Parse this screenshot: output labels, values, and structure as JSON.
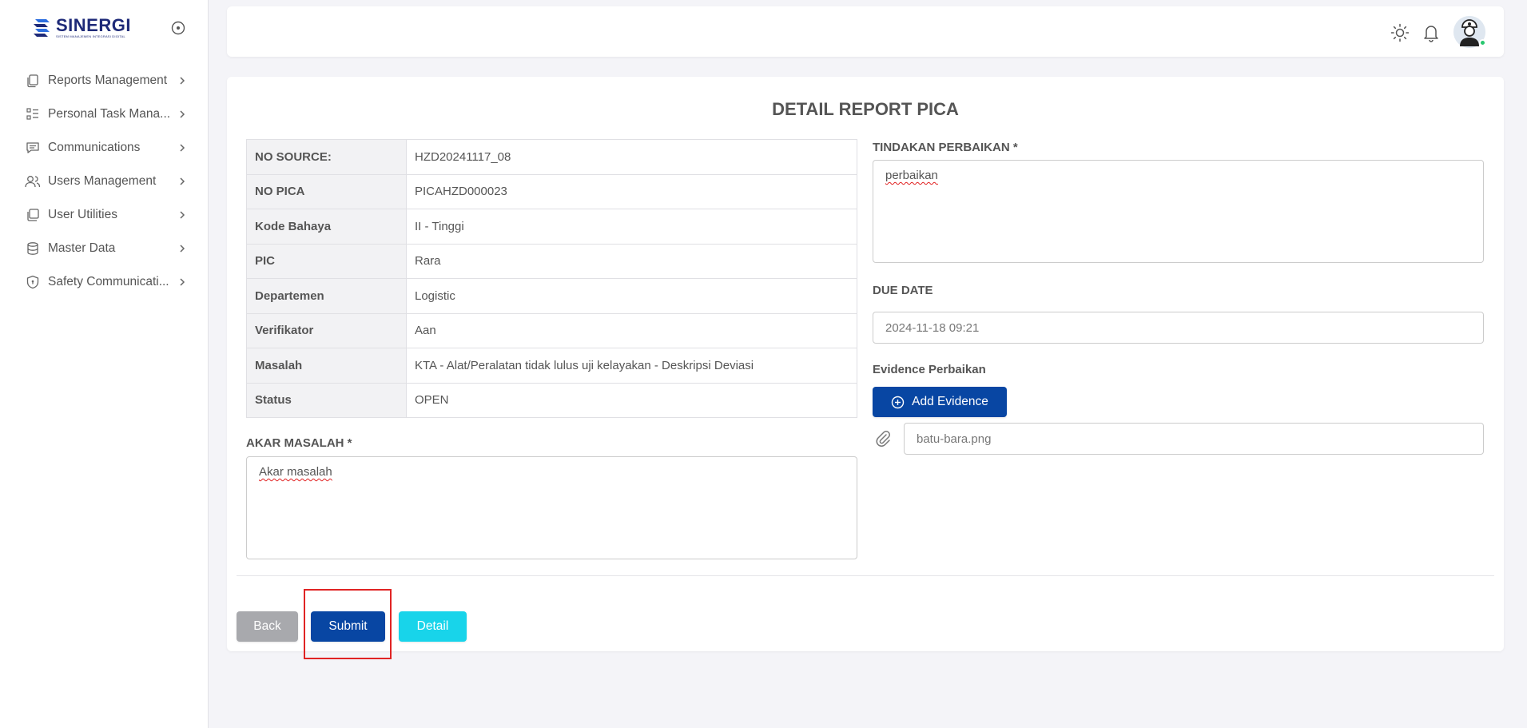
{
  "brand": {
    "name": "SINERGI",
    "subtitle": "SISTEM MANAJEMEN INTEGRASI DIGITAL",
    "logo_icon": "sinergi-logo-icon"
  },
  "sidebar": {
    "items": [
      {
        "label": "Reports Management",
        "icon": "copy-icon"
      },
      {
        "label": "Personal Task Mana...",
        "icon": "list-check-icon"
      },
      {
        "label": "Communications",
        "icon": "message-icon"
      },
      {
        "label": "Users Management",
        "icon": "users-icon"
      },
      {
        "label": "User Utilities",
        "icon": "stack-icon"
      },
      {
        "label": "Master Data",
        "icon": "database-icon"
      },
      {
        "label": "Safety Communicati...",
        "icon": "shield-icon"
      }
    ]
  },
  "topbar": {
    "icons": [
      "sun-icon",
      "bell-icon"
    ],
    "avatar_status_color": "#28c76f"
  },
  "page": {
    "title": "DETAIL REPORT PICA"
  },
  "details": [
    {
      "key": "NO SOURCE:",
      "value": "HZD20241117_08"
    },
    {
      "key": "NO PICA",
      "value": "PICAHZD000023"
    },
    {
      "key": "Kode Bahaya",
      "value": "II - Tinggi"
    },
    {
      "key": "PIC",
      "value": "Rara"
    },
    {
      "key": "Departemen",
      "value": "Logistic"
    },
    {
      "key": "Verifikator",
      "value": "Aan"
    },
    {
      "key": "Masalah",
      "value": "KTA - Alat/Peralatan tidak lulus uji kelayakan - Deskripsi Deviasi"
    },
    {
      "key": "Status",
      "value": "OPEN"
    }
  ],
  "form": {
    "akar_masalah_label": "AKAR MASALAH *",
    "akar_masalah_value": "Akar masalah",
    "tindakan_label": "TINDAKAN PERBAIKAN *",
    "tindakan_value": "perbaikan",
    "due_date_label": "DUE DATE",
    "due_date_value": "2024-11-18 09:21",
    "evidence_label": "Evidence Perbaikan",
    "add_evidence_label": "Add Evidence",
    "evidence_file": "batu-bara.png"
  },
  "actions": {
    "back_label": "Back",
    "submit_label": "Submit",
    "detail_label": "Detail"
  },
  "colors": {
    "primary": "#0846a3",
    "back": "#a8a9ad",
    "detail": "#18d4ea",
    "highlight": "#e02424"
  }
}
